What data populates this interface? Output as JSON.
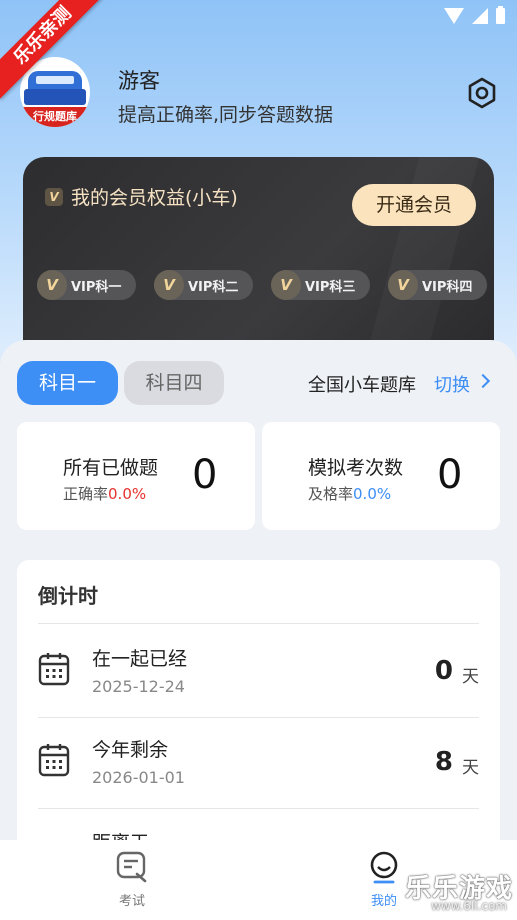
{
  "ribbon": {
    "text": "乐乐亲测"
  },
  "user": {
    "name": "游客",
    "subtitle": "提高正确率,同步答题数据",
    "avatar_text": "行规题库"
  },
  "vip": {
    "title": "我的会员权益(小车)",
    "open_button": "开通会员",
    "badge_letter": "V",
    "chips": [
      {
        "letter": "V",
        "label": "VIP科一"
      },
      {
        "letter": "V",
        "label": "VIP科二"
      },
      {
        "letter": "V",
        "label": "VIP科三"
      },
      {
        "letter": "V",
        "label": "VIP科四"
      }
    ]
  },
  "subject_tabs": [
    {
      "label": "科目一",
      "active": true
    },
    {
      "label": "科目四",
      "active": false
    }
  ],
  "question_bank": {
    "label": "全国小车题库",
    "switch_label": "切换"
  },
  "stats": [
    {
      "title": "所有已做题",
      "sub_label": "正确率",
      "pct": "0.0%",
      "value": "0"
    },
    {
      "title": "模拟考次数",
      "sub_label": "及格率",
      "pct": "0.0%",
      "value": "0"
    }
  ],
  "countdown": {
    "title": "倒计时",
    "rows": [
      {
        "label": "在一起已经",
        "date": "2025-12-24",
        "value": "0",
        "unit": "天"
      },
      {
        "label": "今年剩余",
        "date": "2026-01-01",
        "value": "8",
        "unit": "天"
      },
      {
        "label": "距离天..."
      }
    ]
  },
  "bottom_nav": [
    {
      "label": "考试",
      "icon": "exam-icon",
      "active": false
    },
    {
      "label": "我的",
      "icon": "mine-icon",
      "active": true
    }
  ],
  "watermark": {
    "text": "乐乐游戏",
    "url": "www.6ll.com"
  },
  "colors": {
    "accent": "#3d8ef5",
    "red": "#e5322d",
    "vip_gold": "#fbe3bd",
    "vip_card": "#2d2d2f"
  }
}
